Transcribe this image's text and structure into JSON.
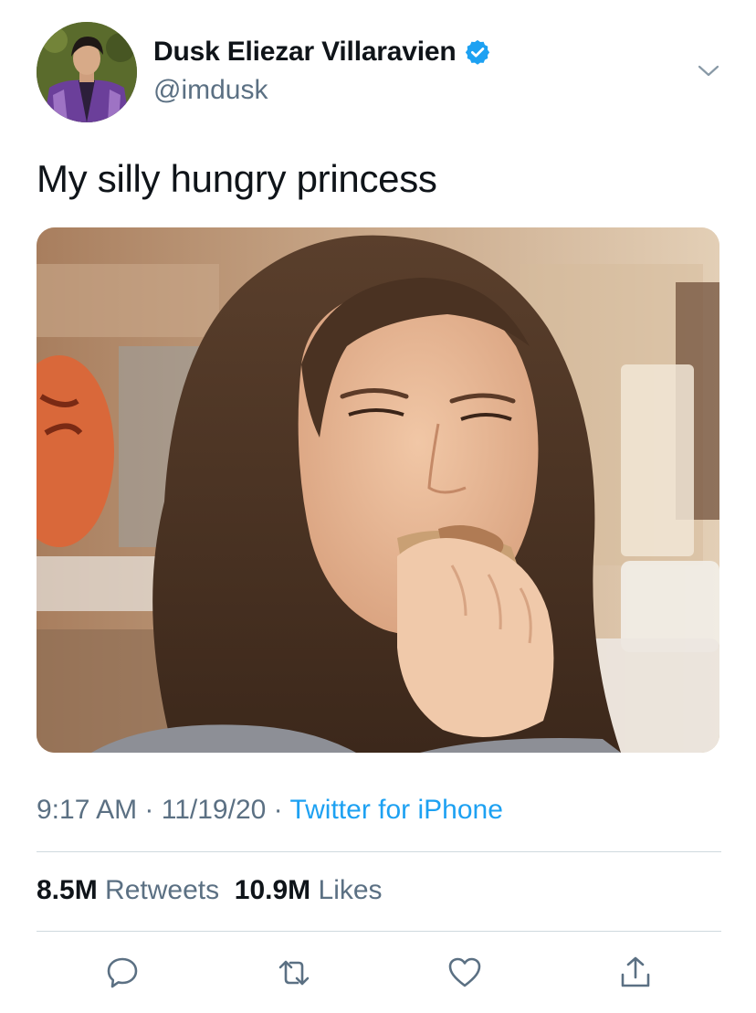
{
  "author": {
    "display_name": "Dusk Eliezar Villaravien",
    "handle": "@imdusk",
    "verified": true
  },
  "tweet": {
    "text": "My silly hungry princess",
    "time": "9:17 AM",
    "date": "11/19/20",
    "source": "Twitter for iPhone",
    "separator": "·"
  },
  "stats": {
    "retweets_count": "8.5M",
    "retweets_label": "Retweets",
    "likes_count": "10.9M",
    "likes_label": "Likes"
  },
  "actions": {
    "reply_icon": "reply-icon",
    "retweet_icon": "retweet-icon",
    "like_icon": "heart-icon",
    "share_icon": "share-icon"
  },
  "colors": {
    "text": "#0f1419",
    "secondary": "#5b7083",
    "link": "#1da1f2",
    "divider": "#cfd9de"
  }
}
